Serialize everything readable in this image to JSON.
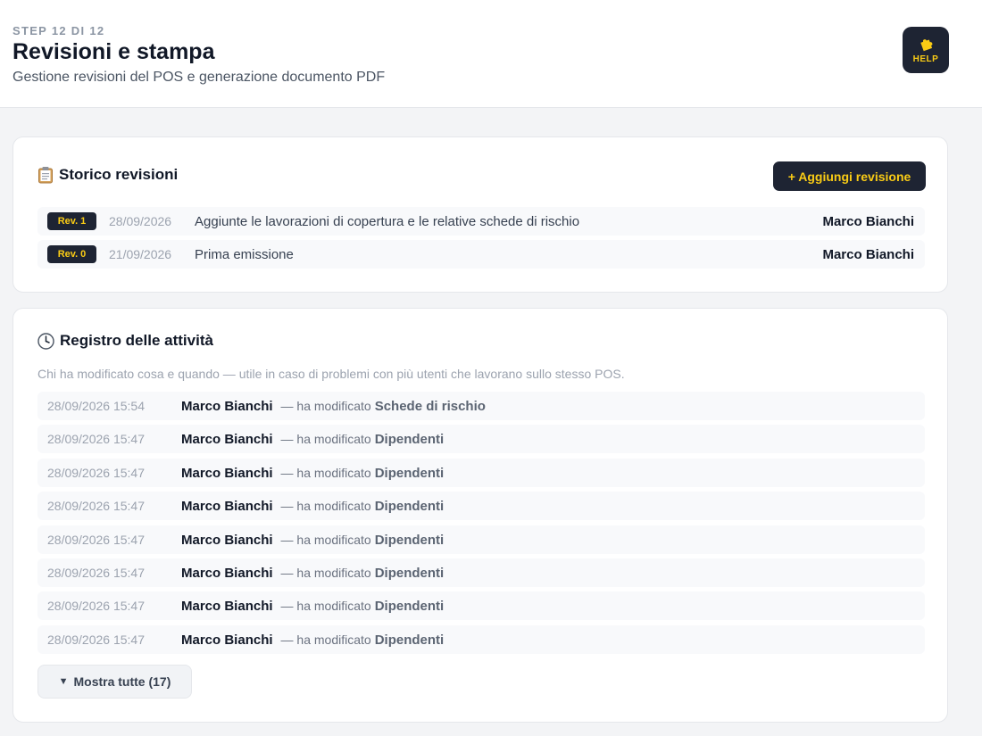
{
  "header": {
    "step": "STEP 12 DI 12",
    "title": "Revisioni e stampa",
    "subtitle": "Gestione revisioni del POS e generazione documento PDF",
    "help_label": "HELP",
    "help_icon": "help-puzzle-icon"
  },
  "revisioni": {
    "title": "Storico revisioni",
    "icon": "clipboard-icon",
    "add_button": "+ Aggiungi revisione",
    "items": [
      {
        "badge": "Rev. 1",
        "date": "28/09/2026",
        "description": "Aggiunte le lavorazioni di copertura e le relative schede di rischio",
        "author": "Marco Bianchi"
      },
      {
        "badge": "Rev. 0",
        "date": "21/09/2026",
        "description": "Prima emissione",
        "author": "Marco Bianchi"
      }
    ]
  },
  "registro": {
    "title": "Registro delle attività",
    "icon": "clock-icon",
    "description": "Chi ha modificato cosa e quando — utile in caso di problemi con più utenti che lavorano sullo stesso POS.",
    "items": [
      {
        "time": "28/09/2026 15:54",
        "user": "Marco Bianchi",
        "verb": "— ha modificato",
        "target": "Schede di rischio"
      },
      {
        "time": "28/09/2026 15:47",
        "user": "Marco Bianchi",
        "verb": "— ha modificato",
        "target": "Dipendenti"
      },
      {
        "time": "28/09/2026 15:47",
        "user": "Marco Bianchi",
        "verb": "— ha modificato",
        "target": "Dipendenti"
      },
      {
        "time": "28/09/2026 15:47",
        "user": "Marco Bianchi",
        "verb": "— ha modificato",
        "target": "Dipendenti"
      },
      {
        "time": "28/09/2026 15:47",
        "user": "Marco Bianchi",
        "verb": "— ha modificato",
        "target": "Dipendenti"
      },
      {
        "time": "28/09/2026 15:47",
        "user": "Marco Bianchi",
        "verb": "— ha modificato",
        "target": "Dipendenti"
      },
      {
        "time": "28/09/2026 15:47",
        "user": "Marco Bianchi",
        "verb": "— ha modificato",
        "target": "Dipendenti"
      },
      {
        "time": "28/09/2026 15:47",
        "user": "Marco Bianchi",
        "verb": "— ha modificato",
        "target": "Dipendenti"
      }
    ],
    "show_all": "Mostra tutte (17)",
    "show_all_caret": "▼"
  },
  "colors": {
    "accent": "#facc15",
    "dark": "#1e2433",
    "background": "#f3f4f6"
  }
}
